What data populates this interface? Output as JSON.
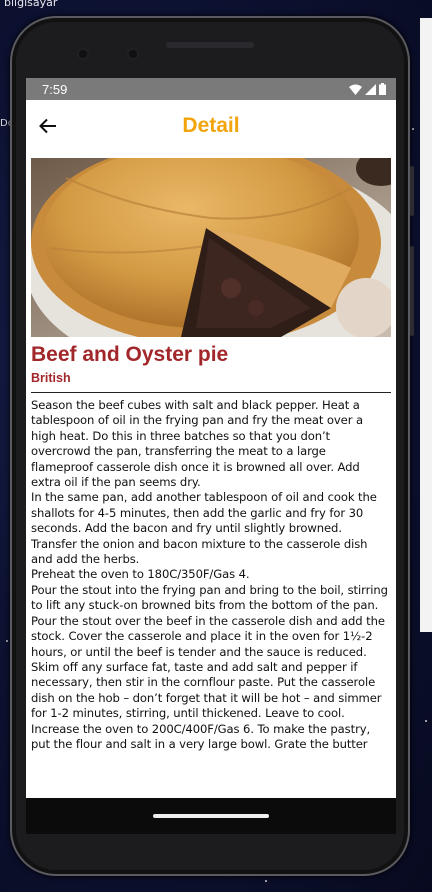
{
  "desktop": {
    "label": "bilgisayar",
    "edge_text": "Do"
  },
  "status_bar": {
    "time": "7:59",
    "icons": [
      "wifi-icon",
      "signal-icon",
      "battery-icon"
    ]
  },
  "app_bar": {
    "title": "Detail",
    "title_color": "#f2a40c",
    "back_icon": "arrow-left-icon"
  },
  "recipe": {
    "name": "Beef and Oyster pie",
    "area": "British",
    "accent_color": "#a2272b",
    "instructions": "Season the beef cubes with salt and black pepper. Heat a tablespoon of oil in the frying pan and fry the meat over a high heat. Do this in three batches so that you don’t overcrowd the pan, transferring the meat to a large flameproof casserole dish once it is browned all over. Add extra oil if the pan seems dry.\nIn the same pan, add another tablespoon of oil and cook the shallots for 4-5 minutes, then add the garlic and fry for 30 seconds. Add the bacon and fry until slightly browned. Transfer the onion and bacon mixture to the casserole dish and add the herbs.\nPreheat the oven to 180C/350F/Gas 4.\nPour the stout into the frying pan and bring to the boil, stirring to lift any stuck-on browned bits from the bottom of the pan. Pour the stout over the beef in the casserole dish and add the stock. Cover the casserole and place it in the oven for 1½-2 hours, or until the beef is tender and the sauce is reduced.\nSkim off any surface fat, taste and add salt and pepper if necessary, then stir in the cornflour paste. Put the casserole dish on the hob – don’t forget that it will be hot – and simmer for 1-2 minutes, stirring, until thickened. Leave to cool.\nIncrease the oven to 200C/400F/Gas 6. To make the pastry, put the flour and salt in a very large bowl. Grate the butter"
  }
}
